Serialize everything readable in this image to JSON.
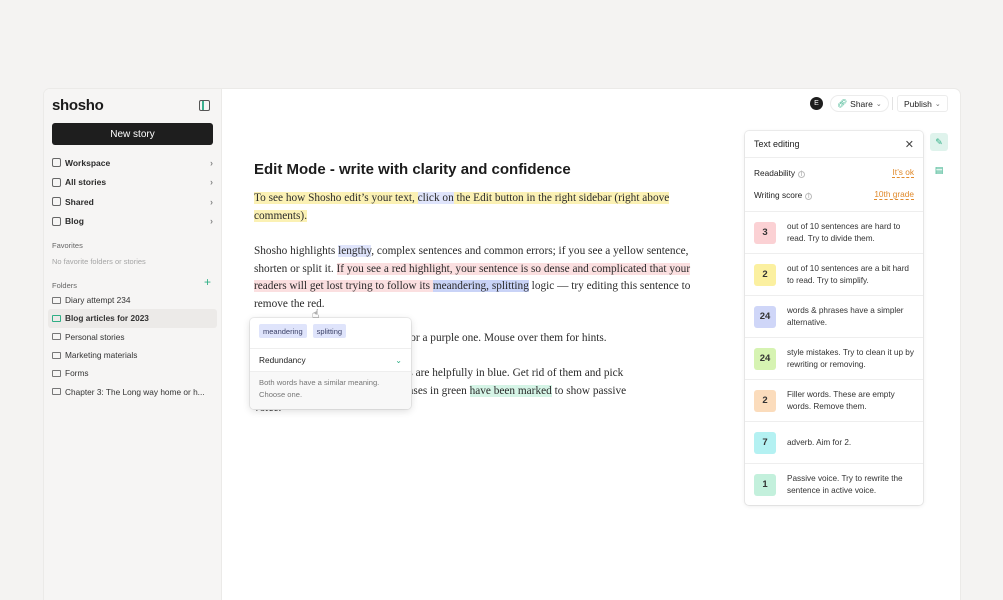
{
  "sidebar": {
    "logo": "shosho",
    "new_story": "New story",
    "nav": [
      {
        "label": "Workspace",
        "icon": "workspace-icon"
      },
      {
        "label": "All stories",
        "icon": "document-icon"
      },
      {
        "label": "Shared",
        "icon": "shared-icon"
      },
      {
        "label": "Blog",
        "icon": "blog-icon"
      }
    ],
    "favorites_label": "Favorites",
    "favorites_empty": "No favorite folders or stories",
    "folders_label": "Folders",
    "folders": [
      "Diary attempt 234",
      "Blog articles for 2023",
      "Personal stories",
      "Marketing materials",
      "Forms",
      "Chapter 3: The Long way home or h..."
    ]
  },
  "topbar": {
    "avatar": "E",
    "share": "Share",
    "publish": "Publish"
  },
  "editor": {
    "title": "Edit Mode - write with clarity and confidence",
    "p1_a": "To see how Shosho edit’s your text, ",
    "p1_b": "click on",
    "p1_c": " the Edit button in the right sidebar (right above comments).",
    "p2_a": "Shosho highlights ",
    "p2_b": "lengthy",
    "p2_c": ", complex sentences and common errors; if you see a yellow sentence, shorten or split it. ",
    "p2_d": "If you see a red highlight, your sentence is so dense and complicated that your readers will get lost trying to follow its ",
    "p2_e": "meandering, splitting",
    "p2_f": " logic — try editing this sentence to remove the red.",
    "p3": "d for a purple one. Mouse over them for hints.",
    "p4_a": "ses are helpfully in blue. Get rid of them and pick",
    "p4_b": "hrases in green ",
    "p4_c": "have been marked",
    "p4_d": " to show passive",
    "p4_e": "voice."
  },
  "popover": {
    "chips": [
      "meandering",
      "splitting"
    ],
    "type": "Redundancy",
    "description": "Both words have a similar meaning. Choose one."
  },
  "panel": {
    "title": "Text editing",
    "readability_label": "Readability",
    "readability_value": "It’s ok",
    "score_label": "Writing score",
    "score_value": "10th grade",
    "issues": [
      {
        "count": "3",
        "text": "out of 10 sentences are hard to read. Try to divide them.",
        "color": "#fbd1d4"
      },
      {
        "count": "2",
        "text": "out of 10 sentences are a bit hard to read. Try to simplify.",
        "color": "#fbf0a0"
      },
      {
        "count": "24",
        "text": "words & phrases have a simpler alternative.",
        "color": "#cfd6f8"
      },
      {
        "count": "24",
        "text": "style mistakes. Try to clean it up by rewriting or removing.",
        "color": "#d6f3b2"
      },
      {
        "count": "2",
        "text": "Filler words. These are empty words. Remove them.",
        "color": "#fbdcbc"
      },
      {
        "count": "7",
        "text": "adverb. Aim for 2.",
        "color": "#b4f1f2"
      },
      {
        "count": "1",
        "text": "Passive voice. Try to rewrite the sentence in active voice.",
        "color": "#c3f0dc"
      }
    ]
  }
}
